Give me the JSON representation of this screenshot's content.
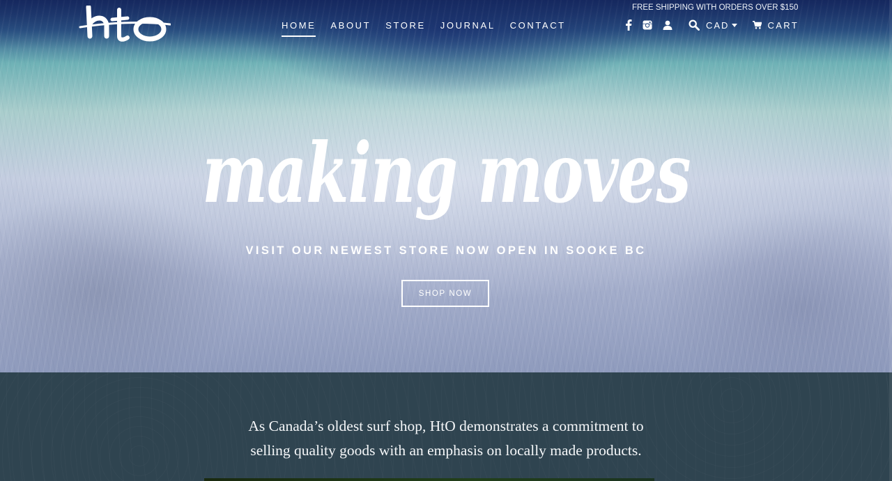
{
  "header": {
    "logo_text": "hto",
    "promo": "FREE SHIPPING WITH ORDERS OVER $150",
    "nav": [
      {
        "label": "HOME",
        "active": true
      },
      {
        "label": "ABOUT",
        "active": false
      },
      {
        "label": "STORE",
        "active": false
      },
      {
        "label": "JOURNAL",
        "active": false
      },
      {
        "label": "CONTACT",
        "active": false
      }
    ],
    "icons": [
      "facebook-icon",
      "instagram-icon",
      "account-icon",
      "search-icon"
    ],
    "currency": "CAD",
    "cart_label": "CART"
  },
  "hero": {
    "headline": "making moves",
    "subheadline": "VISIT OUR NEWEST STORE NOW OPEN IN SOOKE BC",
    "button_label": "SHOP NOW"
  },
  "about": {
    "text": "As Canada’s oldest surf shop, HtO demonstrates a commitment to selling quality goods with an emphasis on locally made products."
  },
  "colors": {
    "about_bg": "#2f4450",
    "text_light": "#ffffff",
    "hero_top": "#1d3470",
    "hero_water": "#6fb2b6"
  }
}
